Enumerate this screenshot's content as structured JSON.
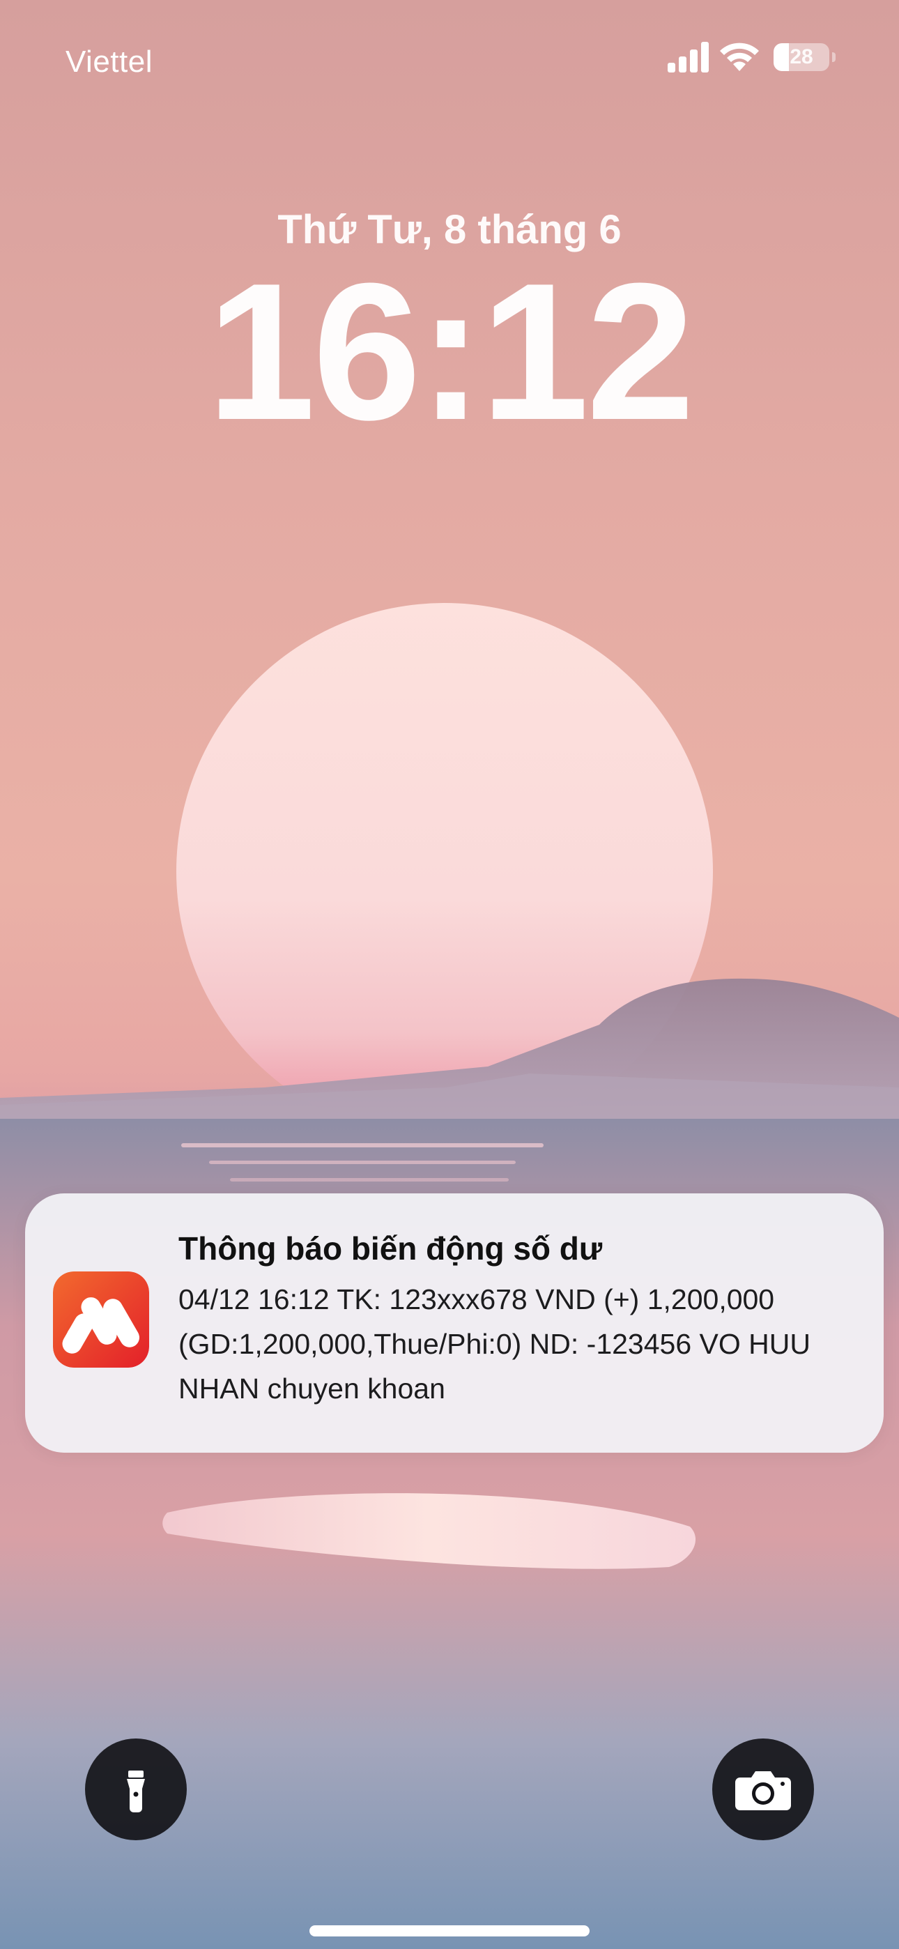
{
  "status_bar": {
    "carrier": "Viettel",
    "battery_level": "28",
    "battery_fraction": 0.28,
    "signal_icon": "cellular-signal-icon",
    "wifi_icon": "wifi-icon",
    "battery_icon": "battery-icon"
  },
  "lock_screen": {
    "date": "Thứ Tư, 8 tháng 6",
    "time": "16:12"
  },
  "notification": {
    "app_icon": "bank-app-icon",
    "title": "Thông báo biến động số dư",
    "body": "04/12 16:12 TK: 123xxx678 VND (+) 1,200,000 (GD:1,200,000,Thue/Phi:0) ND: -123456 VO HUU NHAN chuyen khoan"
  },
  "quick_actions": {
    "flashlight_icon": "flashlight-icon",
    "camera_icon": "camera-icon"
  },
  "colors": {
    "notification_background": "#F2F2F6",
    "app_icon_red": "#E8262B",
    "app_icon_orange": "#F26A2E",
    "quick_button_background": "#141418"
  }
}
